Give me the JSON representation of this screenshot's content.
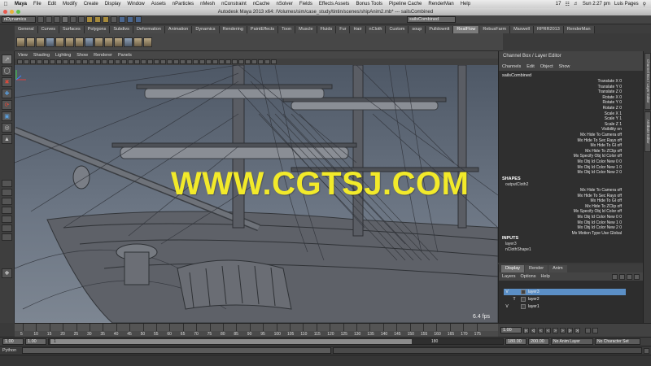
{
  "menubar": {
    "items": [
      "Maya",
      "File",
      "Edit",
      "Modify",
      "Create",
      "Display",
      "Window",
      "Assets",
      "nParticles",
      "nMesh",
      "nConstraint",
      "nCache",
      "nSolver",
      "Fields",
      "Effects Assets",
      "Bonus Tools",
      "Pipeline Cache",
      "RenderMan",
      "Help"
    ],
    "badge": "17",
    "clock": "Sun 2:27 pm",
    "user": "Luis Pages"
  },
  "window": {
    "title": "Autodesk Maya 2013 x64: /Volumes/sim/case_study/tintin/scenes/shipAnim2.mb*  ---  sailsCombined"
  },
  "status_line": {
    "mode": "nDynamics",
    "render_field": "sailsCombined"
  },
  "shelf": {
    "tabs": [
      "General",
      "Curves",
      "Surfaces",
      "Polygons",
      "Subdivs",
      "Deformation",
      "Animation",
      "Dynamics",
      "Rendering",
      "PaintEffects",
      "Toon",
      "Muscle",
      "Fluids",
      "Fur",
      "Hair",
      "nCloth",
      "Custom",
      "soup",
      "Pulldownlt",
      "RealFlow",
      "RebusFarm",
      "Maxwell",
      "RPRR2013",
      "RenderMan"
    ],
    "active_tab": "RealFlow"
  },
  "viewport": {
    "menu": [
      "View",
      "Shading",
      "Lighting",
      "Show",
      "Renderer",
      "Panels"
    ],
    "fps": "6.4 fps"
  },
  "watermark": "WWW.CGTSJ.COM",
  "channel_box": {
    "title": "Channel Box / Layer Editor",
    "menu": [
      "Channels",
      "Edit",
      "Object",
      "Show"
    ],
    "object": "sailsCombined",
    "attributes": [
      "Translate X 0",
      "Translate Y 0",
      "Translate Z 0",
      "Rotate X 0",
      "Rotate Y 0",
      "Rotate Z 0",
      "Scale X 1",
      "Scale Y 1",
      "Scale Z 1",
      "Visibility on",
      "Mx Hide To Camera off",
      "Mx Hide To Sec Rays off",
      "Mx Hide To GI off",
      "Mx Hide To ZClip off",
      "Mx Specify Obj Id Color off",
      "Mx Obj Id Color New 0 0",
      "Mx Obj Id Color New 1 0",
      "Mx Obj Id Color New 2 0"
    ],
    "shapes_label": "SHAPES",
    "shape_name": "outputCloth2",
    "shape_attributes": [
      "Mx Hide To Camera off",
      "Mx Hide To Sec Rays off",
      "Mx Hide To GI off",
      "Mx Hide To ZClip off",
      "Mx Specify Obj Id Color off",
      "Mx Obj Id Color New 0 0",
      "Mx Obj Id Color New 1 0",
      "Mx Obj Id Color New 2 0",
      "Mx Motion Type Use Global"
    ],
    "inputs_label": "INPUTS",
    "inputs": [
      "layer3",
      "nClothShape1"
    ]
  },
  "side_tabs": [
    "Channel Box / Layer Editor",
    "Attribute Editor"
  ],
  "layer_editor": {
    "tabs": [
      "Display",
      "Render",
      "Anim"
    ],
    "active_tab": "Display",
    "menu": [
      "Layers",
      "Options",
      "Help"
    ],
    "layers": [
      {
        "name": "layer3",
        "v": "V",
        "t": "",
        "selected": true
      },
      {
        "name": "layer2",
        "v": "",
        "t": "T",
        "selected": false
      },
      {
        "name": "layer1",
        "v": "V",
        "t": "",
        "selected": false
      }
    ]
  },
  "timeline": {
    "labels": [
      "5",
      "10",
      "15",
      "20",
      "25",
      "30",
      "35",
      "40",
      "45",
      "50",
      "55",
      "60",
      "65",
      "70",
      "75",
      "80",
      "85",
      "90",
      "95",
      "100",
      "105",
      "110",
      "115",
      "120",
      "125",
      "130",
      "135",
      "140",
      "145",
      "150",
      "155",
      "160",
      "165",
      "170",
      "175"
    ],
    "current_frame": "1.00"
  },
  "playback": {
    "buttons": [
      "|<",
      "<|",
      "<",
      "<",
      ">",
      ">",
      "|>",
      ">|"
    ]
  },
  "range": {
    "start": "1.00",
    "playback_start": "1.00",
    "knob_left": "1",
    "knob_right": "180",
    "playback_end": "180.00",
    "end": "200.00",
    "anim_layer": "No Anim Layer",
    "character_set": "No Character Set"
  },
  "command_line": {
    "language": "Python"
  },
  "colors": {
    "watermark": "#f2ea2a",
    "layer_selected": "#5b8fc6",
    "active_shelf_tab": "#7a7a7a"
  }
}
